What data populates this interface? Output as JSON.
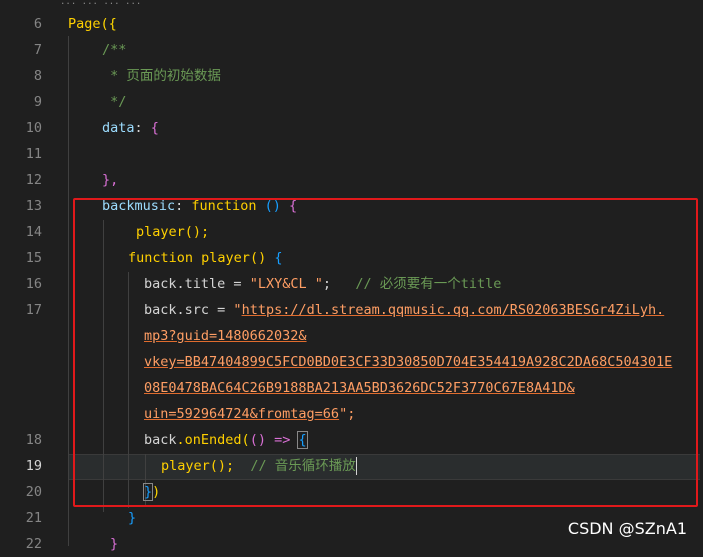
{
  "editor": {
    "line_numbers": [
      "6",
      "7",
      "8",
      "9",
      "10",
      "11",
      "12",
      "13",
      "14",
      "15",
      "16",
      "17",
      "",
      "",
      "",
      "",
      "18",
      "19",
      "20",
      "21",
      "22"
    ],
    "current_line": "19"
  },
  "code": {
    "l6_page": "Page",
    "l6_open": "({",
    "l7_comment": "/**",
    "l8_comment": " * 页面的初始数据",
    "l9_comment": " */",
    "l10_data": "data",
    "l10_colon": ": ",
    "l10_brace": "{",
    "l12_close": "},",
    "l13_name": "backmusic",
    "l13_colon": ": ",
    "l13_function": "function",
    "l13_parens": " () ",
    "l13_brace": "{",
    "l14_call": "player",
    "l14_parens": "();",
    "l15_function": "function",
    "l15_name": " player",
    "l15_parens": "() ",
    "l15_brace": "{",
    "l16_obj": "back",
    "l16_prop": ".title",
    "l16_eq": " = ",
    "l16_str": "\"LXY&CL \"",
    "l16_semi": ";   ",
    "l16_comment": "// 必须要有一个title",
    "l17_obj": "back",
    "l17_prop": ".src",
    "l17_eq": " = ",
    "l17_quote": "\"",
    "l17_url1": "https://dl.stream.qqmusic.qq.com/RS02063BESGr4ZiLyh.",
    "l17_url2": "mp3?guid=1480662032&",
    "l17_url3": "vkey=BB47404899C5FCD0BD0E3CF33D30850D704E354419A928C2DA68C504301E",
    "l17_url4": "08E0478BAC64C26B9188BA213AA5BD3626DC52F3770C67E8A41D&",
    "l17_url5": "uin=592964724&fromtag=66",
    "l17_end": "\";",
    "l18_obj": "back",
    "l18_method": ".onEnded",
    "l18_open": "(",
    "l18_args": "() => ",
    "l18_brace": "{",
    "l19_call": "player",
    "l19_parens": "();  ",
    "l19_comment": "// 音乐循环播放",
    "l20_brace": "}",
    "l20_paren": ")",
    "l21_brace": "}",
    "l22_brace": "}"
  },
  "watermark": "CSDN @SZnA1",
  "top_partial": "... ... ... ...",
  "colors": {
    "background": "#1f1f1f",
    "highlight_box": "#e0191b",
    "keyword": "#ffd000",
    "string": "#ff9e64",
    "comment": "#6a9955",
    "property": "#9cdcfe"
  }
}
